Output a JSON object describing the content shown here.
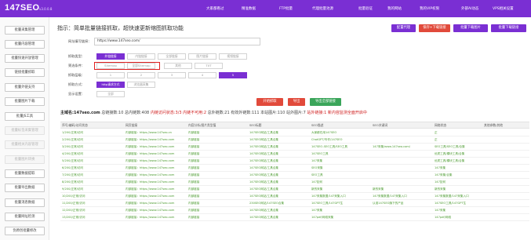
{
  "app": {
    "logo": "147SEO",
    "version": "v3.0.0.8",
    "nav": [
      "大家都看过",
      "精准数据",
      "FTP批量",
      "代理批量池源",
      "批量验证",
      "我的网站",
      "我的VIP权限",
      "外部AI动态",
      "VPS相关设置"
    ]
  },
  "sidebar": {
    "items": [
      {
        "label": "批量采集管理",
        "enabled": true
      },
      {
        "label": "批量内容管理",
        "enabled": true
      },
      {
        "label": "批量快速开放管理",
        "enabled": true
      },
      {
        "label": "链接批量抓取",
        "enabled": true
      },
      {
        "label": "批量外链支持",
        "enabled": true
      },
      {
        "label": "批量图片下载",
        "enabled": true
      },
      {
        "label": "批量JS工具",
        "enabled": true
      },
      {
        "label": "批量标签采集管理",
        "enabled": false
      },
      {
        "label": "批量相关内容管理",
        "enabled": false
      },
      {
        "label": "批量图片转换",
        "enabled": false
      },
      {
        "label": "批量数据提取",
        "enabled": true
      },
      {
        "label": "批量导出数据",
        "enabled": true
      },
      {
        "label": "批量消息数据",
        "enabled": true
      },
      {
        "label": "批量网址检测",
        "enabled": true
      },
      {
        "label": "伪原创批量修改",
        "enabled": true
      }
    ]
  },
  "main": {
    "hint": "指示：简单批量链接抓取，超快速更新缩图抓取功能",
    "top_buttons": [
      {
        "label": "配置代理",
        "color": "#7a2fd3"
      },
      {
        "label": "保存+下载链接",
        "color": "#e14a3b"
      },
      {
        "label": "批量下载图片",
        "color": "#7a2fd3"
      },
      {
        "label": "批量下载链接",
        "color": "#7a2fd3"
      }
    ],
    "form": {
      "url_label": "网址填写链接：",
      "url_value": "https://www.147seo.com/",
      "rows": [
        {
          "label": "抓取类型：",
          "options": [
            {
              "text": "外链链接",
              "on": true
            },
            {
              "text": "内链链接",
              "on": false
            },
            {
              "text": "全部链接",
              "on": false
            },
            {
              "text": "图片链接",
              "on": false
            },
            {
              "text": "视频链接",
              "on": false
            }
          ]
        },
        {
          "label": "筛选条件：",
          "options": [
            {
              "text": "Sitemap",
              "on": false
            },
            {
              "text": "全部Sitemap",
              "on": false
            },
            {
              "text": "其他",
              "on": false
            },
            {
              "text": "TXT",
              "on": false
            }
          ]
        },
        {
          "label": "抓取层级：",
          "options": [
            {
              "text": "1",
              "on": false
            },
            {
              "text": "2",
              "on": false
            },
            {
              "text": "3",
              "on": false
            },
            {
              "text": "4",
              "on": false
            },
            {
              "text": "5",
              "on": true
            }
          ]
        },
        {
          "label": "抓取方式：",
          "options": [
            {
              "text": "http请求方式",
              "on": true
            },
            {
              "text": "浏览器采集",
              "on": false
            }
          ]
        },
        {
          "label": "显示设置：",
          "options": [
            {
              "text": "全部",
              "on": false
            }
          ]
        }
      ]
    },
    "actions": [
      {
        "label": "开始抓取",
        "color": "#e14a3b"
      },
      {
        "label": "导出",
        "color": "#e14a3b"
      },
      {
        "label": "导出全部链接",
        "color": "#3aa55a"
      }
    ],
    "summary": {
      "domain": "主域名:147seo.com",
      "parts": [
        "总链接数:10",
        "总内链数:408",
        "内链访问状态:3/3",
        "内链不可用:2",
        "总外链数:21",
        "有效外链数:111",
        "本站图片:110",
        "站外图片:7",
        "站外链接:1",
        "新内容监测全面开启中"
      ]
    },
    "table": {
      "headers": [
        "序号/编码/访问状态",
        "网页链接",
        "内容分析/图片类型值",
        "SEO标题",
        "SEO描述",
        "SEO关键词",
        "网络状态",
        "其他参数/其他"
      ],
      "rows": [
        [
          "1/200/正常/访问",
          "内部链接：https://www.147seo.cn",
          "内部链接",
          "147SEO网站/工具合集",
          "大家都在用147SEO",
          "",
          "正",
          ""
        ],
        [
          "2/200/正常/访问",
          "内部链接：https://www.147seo.com",
          "内部链接",
          "147SEO网站/工具合集",
          "ChatGPT/写作/147SEO",
          "",
          "正",
          ""
        ],
        [
          "3/200/正常/访问",
          "内部链接：https://www.147seo.com",
          "内部链接",
          "147SEO网站/工具合集",
          "147SEO-SEO工具/SEO工具",
          "147采集/www.147seo.com/",
          "SEO工具/SEO工具/合集",
          ""
        ],
        [
          "4/200/正常/访问",
          "内部链接：https://www.147seo.com",
          "内部链接",
          "147SEO网站/工具合集",
          "147SEO工具",
          "",
          "优质工具/模块工具/合集",
          ""
        ],
        [
          "5/200/正常/访问",
          "内部链接：https://www.147seo.com",
          "内部链接",
          "147SEO网站/工具合集",
          "147采集",
          "",
          "优质工具/模块工具/合集",
          ""
        ],
        [
          "6/200/正常/访问",
          "内部链接：https://www.147seo.com",
          "内部链接",
          "147SEO网站/工具合集",
          "SEO采集",
          "",
          "147采集",
          ""
        ],
        [
          "7/200/正常/访问",
          "内部链接：https://www.147seo.com",
          "内部链接",
          "147SEO网站/工具合集",
          "SEO工具",
          "",
          "147采集/合集",
          ""
        ],
        [
          "8/200/正常/访问",
          "内部链接：https://www.147seo.com",
          "内部链接",
          "147SEO网站/工具合集",
          "147如何",
          "",
          "147如何",
          ""
        ],
        [
          "9/200/正常/访问",
          "内部链接：https://www.147seo.com",
          "内部链接",
          "147SEO网站/工具合集",
          "新的采集",
          "新的采集",
          "新的采集",
          ""
        ],
        [
          "10/200/正常/访问",
          "内部链接：https://www.147seo.com",
          "内部链接",
          "147SEO网站/工具合集",
          "147采集数据/147采集入口",
          "147采集数据/147采集入口",
          "147采集数据/147采集入口",
          ""
        ],
        [
          "11/200/正常/访问",
          "内部链接：https://www.147seo.com",
          "内部链接",
          "230SEO网站/147SEO合集",
          "147SEO工具/147GPT生",
          "认准147SEO旗下的产品",
          "147SEO工具/147GPT生",
          ""
        ],
        [
          "12/200/正常/访问",
          "内部链接：https://www.147seo.com",
          "内部链接",
          "147SEO网站/工具合集",
          "147采集",
          "",
          "147采集",
          ""
        ],
        [
          "13/200/正常/访问",
          "内部链接：https://www.147seo.com",
          "内部链接",
          "147SEO网站/工具合集",
          "147pdf/网络采集",
          "",
          "147pdf/网络",
          ""
        ]
      ]
    }
  },
  "colors": {
    "accent": "#7a2fd3",
    "danger": "#e14a3b",
    "success": "#3aa55a",
    "link_text": "#4a9a2e",
    "highlight_box": "#e02020"
  }
}
